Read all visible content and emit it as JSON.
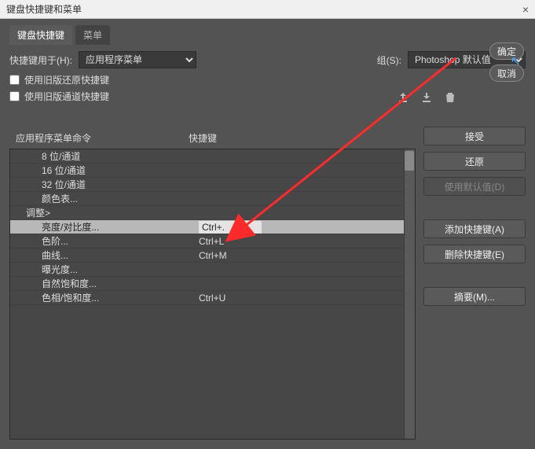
{
  "window": {
    "title": "键盘快捷键和菜单",
    "close_label": "×"
  },
  "tabs": {
    "shortcuts": "键盘快捷键",
    "menus": "菜单"
  },
  "controls": {
    "for_label": "快捷键用于(H):",
    "for_value": "应用程序菜单",
    "set_label": "组(S):",
    "set_value": "Photoshop 默认值",
    "legacy_undo": "使用旧版还原快捷键",
    "legacy_channel": "使用旧版通道快捷键"
  },
  "buttons": {
    "ok": "确定",
    "cancel": "取消",
    "accept": "接受",
    "undo": "还原",
    "use_default": "使用默认值(D)",
    "add_shortcut": "添加快捷键(A)",
    "delete_shortcut": "删除快捷键(E)",
    "summarize": "摘要(M)..."
  },
  "headers": {
    "command": "应用程序菜单命令",
    "shortcut": "快捷键"
  },
  "rows": [
    {
      "label": "8 位/通道",
      "shortcut": "",
      "indent": 1
    },
    {
      "label": "16 位/通道",
      "shortcut": "",
      "indent": 1
    },
    {
      "label": "32 位/通道",
      "shortcut": "",
      "indent": 1
    },
    {
      "label": "颜色表...",
      "shortcut": "",
      "indent": 1
    },
    {
      "label": "调整>",
      "shortcut": "",
      "indent": 0,
      "group": true
    },
    {
      "label": "亮度/对比度...",
      "shortcut": "Ctrl+.",
      "indent": 1,
      "selected": true
    },
    {
      "label": "色阶...",
      "shortcut": "Ctrl+L",
      "indent": 1
    },
    {
      "label": "曲线...",
      "shortcut": "Ctrl+M",
      "indent": 1
    },
    {
      "label": "曝光度...",
      "shortcut": "",
      "indent": 1
    },
    {
      "label": "自然饱和度...",
      "shortcut": "",
      "indent": 1
    },
    {
      "label": "色相/饱和度...",
      "shortcut": "Ctrl+U",
      "indent": 1
    }
  ],
  "icons": {
    "export": "export-icon",
    "import": "import-icon",
    "trash": "trash-icon"
  }
}
